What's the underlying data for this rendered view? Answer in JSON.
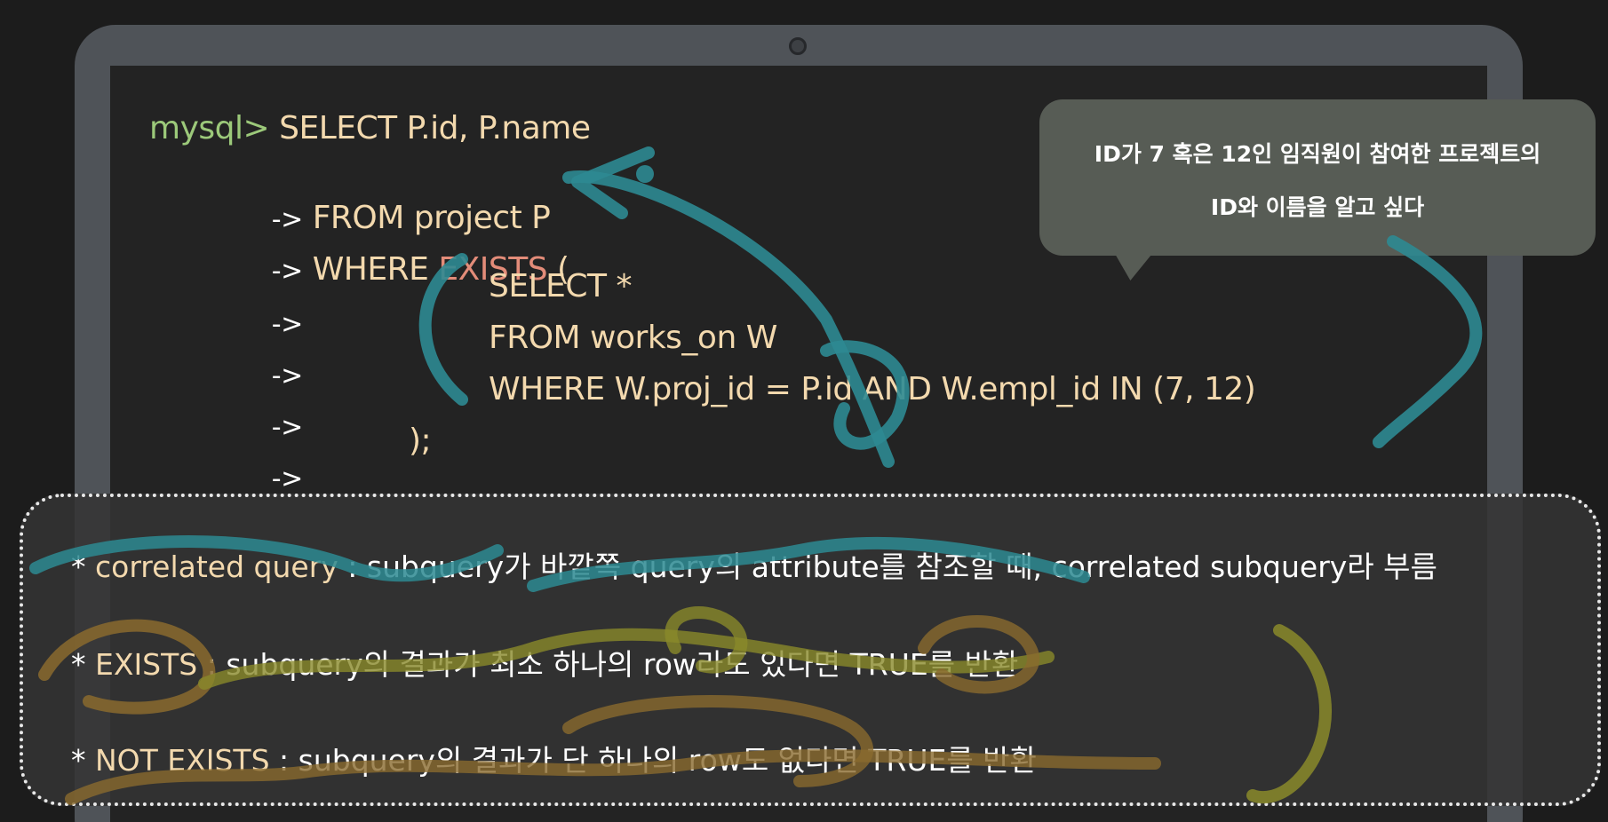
{
  "code": {
    "line1_prompt": "mysql>",
    "line1_text": " SELECT P.id, P.name",
    "line2_arrow": "->",
    "line2_text": "FROM project P",
    "line3_arrow": "->",
    "line3_text_a": "WHERE ",
    "line3_kw": "EXISTS",
    "line3_text_b": " (",
    "line4_arrow": "->",
    "line4_text": "SELECT *",
    "line5_arrow": "->",
    "line5_text": "FROM works_on W",
    "line6_arrow": "->",
    "line6_text": "WHERE W.proj_id = P.id AND W.empl_id IN (7, 12)",
    "line7_arrow": "->",
    "line7_text": ");"
  },
  "bubble": {
    "line1": "ID가 7 혹은 12인 임직원이 참여한 프로젝트의",
    "line2": "ID와 이름을 알고 싶다"
  },
  "notes": {
    "n1_star": "*",
    "n1_term": " correlated query",
    "n1_rest": " : subquery가 바깥쪽 query의 attribute를 참조할 때, correlated subquery라 부름",
    "n2_star": "*",
    "n2_term": " EXISTS",
    "n2_rest": " : subquery의 결과가 최소 하나의 row라도 있다면 TRUE를 반환",
    "n3_star": "*",
    "n3_term": " NOT EXISTS",
    "n3_rest": " : subquery의 결과가 단 하나의 row도 없다면 TRUE를 반환"
  },
  "colors": {
    "prompt": "#9cc97a",
    "code_text": "#f3d9ae",
    "keyword_red": "#e38c79",
    "teal_annotation": "#2d8a92",
    "olive_annotation": "#8a8a2a",
    "brown_annotation": "#8a6a2e"
  },
  "icons": {
    "camera": "webcam-dot-icon"
  }
}
